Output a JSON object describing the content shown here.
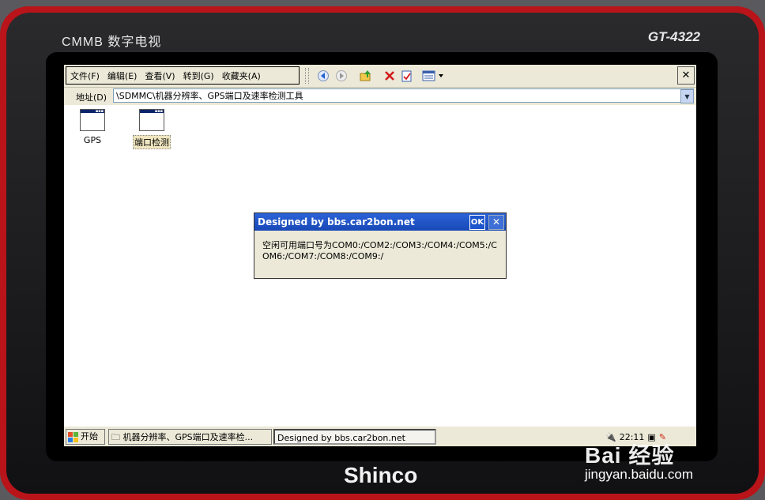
{
  "device": {
    "brand_top": "CMMB 数字电视",
    "model": "GT-4322",
    "brand_bottom": "Shinco"
  },
  "menubar": {
    "items": [
      "文件(F)",
      "编辑(E)",
      "查看(V)",
      "转到(G)",
      "收藏夹(A)"
    ]
  },
  "toolbar": {
    "buttons": [
      "back-icon",
      "forward-icon",
      "up-folder-icon",
      "delete-icon",
      "properties-icon",
      "views-icon"
    ],
    "close_label": "✕"
  },
  "address": {
    "label": "地址(D)",
    "value": "\\SDMMC\\机器分辨率、GPS端口及速率检测工具"
  },
  "files": [
    {
      "label": "GPS",
      "icon": "app-window-icon",
      "selected": false
    },
    {
      "label": "端口检测",
      "icon": "app-window-icon",
      "selected": true
    }
  ],
  "dialog": {
    "title": "Designed by bbs.car2bon.net",
    "ok_label": "OK",
    "close_label": "✕",
    "message": "空闲可用端口号为COM0:/COM2:/COM3:/COM4:/COM5:/COM6:/COM7:/COM8:/COM9:/"
  },
  "taskbar": {
    "start_label": "开始",
    "task1": "机器分辨率、GPS端口及速率检...",
    "task2": "Designed by bbs.car2bon.net",
    "clock": "22:11"
  },
  "watermark": {
    "top": "Bai 经验",
    "bottom": "jingyan.baidu.com"
  },
  "colors": {
    "device_red": "#b8141a",
    "title_blue": "#1848b6",
    "chrome": "#ece9d8"
  }
}
